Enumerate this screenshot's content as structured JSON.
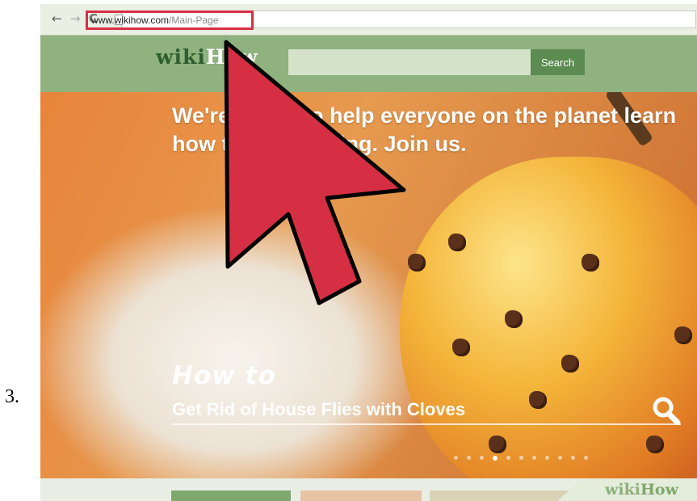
{
  "step": {
    "number": "3."
  },
  "browser": {
    "back_icon": "back-arrow-icon",
    "forward_icon": "forward-arrow-icon",
    "reload_icon": "reload-icon",
    "url_domain": "www.wikihow.com",
    "url_path": "/Main-Page"
  },
  "site": {
    "logo_wiki": "wiki",
    "logo_how": "How",
    "search_button_label": "Search"
  },
  "hero": {
    "tagline": "We're trying to help everyone on the planet learn how to do anything. Join us.",
    "how_to_label": "How to",
    "article_title": "Get Rid of House Flies with Cloves",
    "carousel_total": 11,
    "carousel_active": 3
  },
  "watermark": {
    "wiki": "wiki",
    "how": "How"
  },
  "colors": {
    "highlight": "#d62f44",
    "header_green": "#8fb27f",
    "search_button": "#5c8c51",
    "arrow_fill": "#d62f44",
    "arrow_outline": "#000000"
  }
}
